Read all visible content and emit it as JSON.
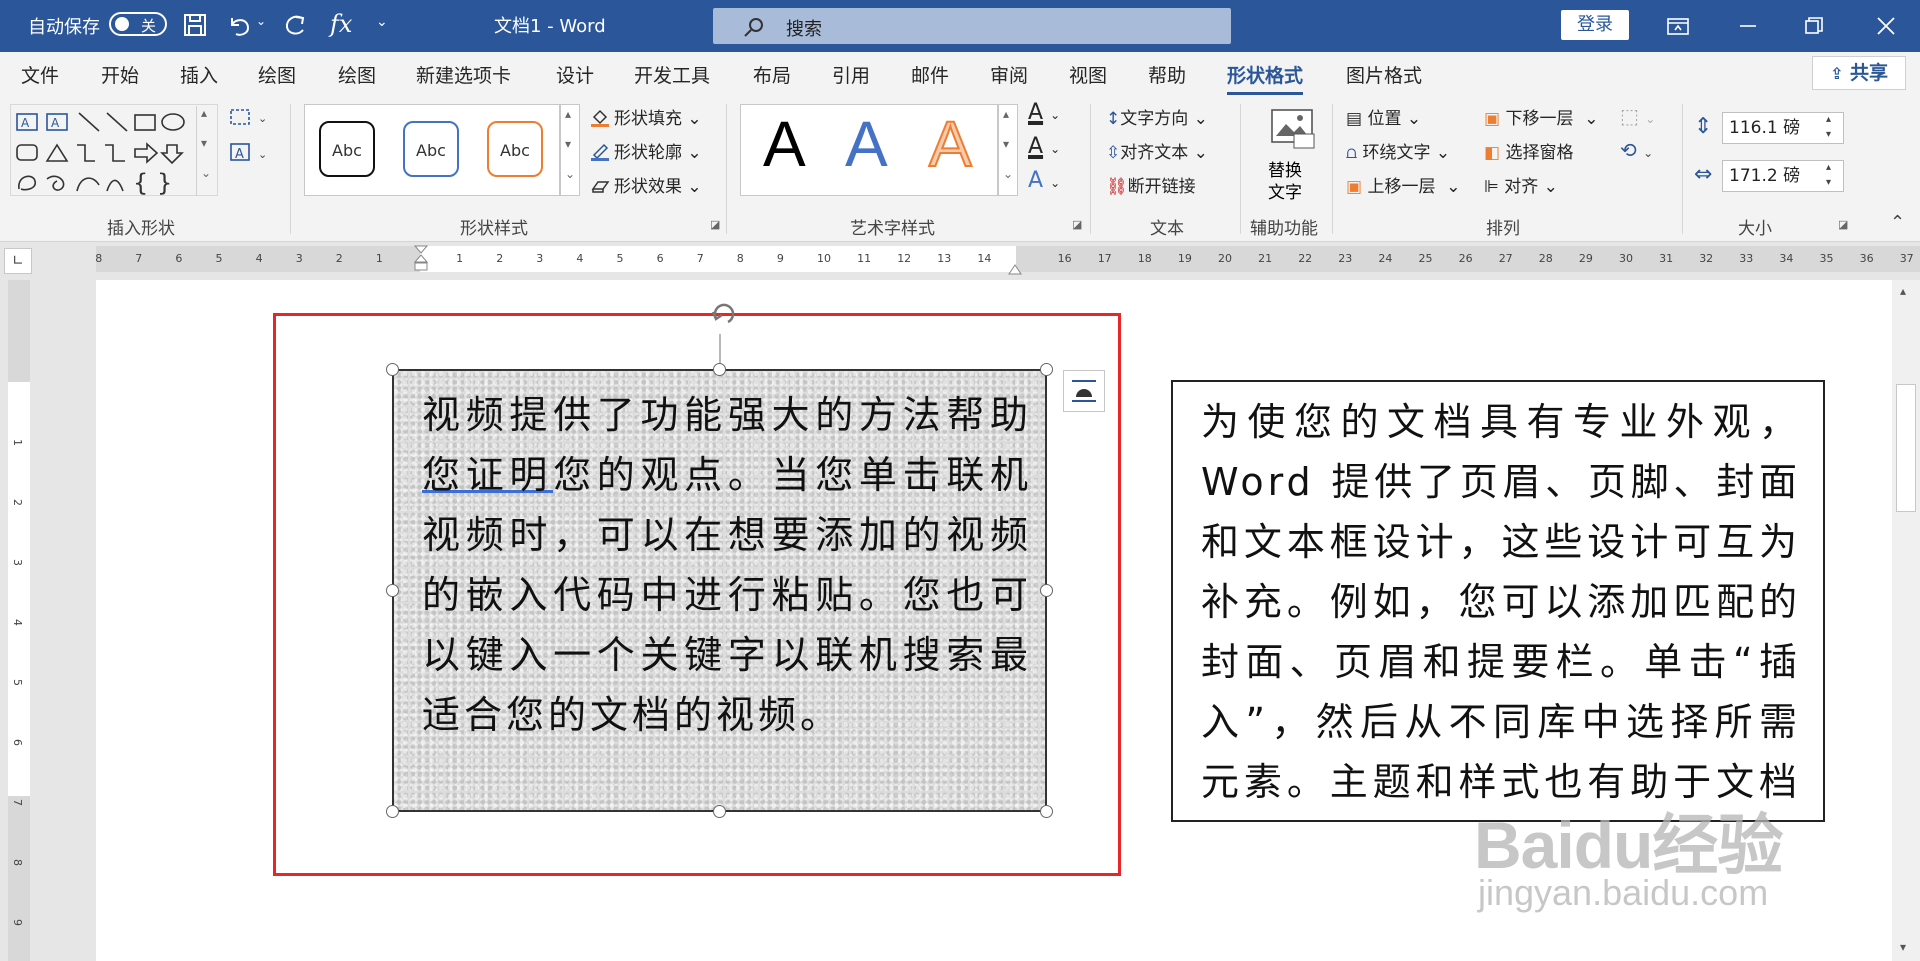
{
  "titlebar": {
    "autosave_label": "自动保存",
    "autosave_state": "关",
    "doc_title": "文档1  -  Word",
    "search_placeholder": "搜索",
    "login_label": "登录"
  },
  "tabs": [
    {
      "label": "文件",
      "active": false
    },
    {
      "label": "开始",
      "active": false
    },
    {
      "label": "插入",
      "active": false
    },
    {
      "label": "绘图",
      "active": false
    },
    {
      "label": "绘图",
      "active": false
    },
    {
      "label": "新建选项卡",
      "active": false
    },
    {
      "label": "设计",
      "active": false
    },
    {
      "label": "开发工具",
      "active": false
    },
    {
      "label": "布局",
      "active": false
    },
    {
      "label": "引用",
      "active": false
    },
    {
      "label": "邮件",
      "active": false
    },
    {
      "label": "审阅",
      "active": false
    },
    {
      "label": "视图",
      "active": false
    },
    {
      "label": "帮助",
      "active": false
    },
    {
      "label": "形状格式",
      "active": true
    },
    {
      "label": "图片格式",
      "active": false
    }
  ],
  "share_label": "共享",
  "ribbon": {
    "groups": {
      "insert_shapes": "插入形状",
      "shape_styles": "形状样式",
      "wordart_styles": "艺术字样式",
      "text": "文本",
      "accessibility": "辅助功能",
      "arrange": "排列",
      "size": "大小"
    },
    "style_gallery": [
      "Abc",
      "Abc",
      "Abc"
    ],
    "shape_fill": "形状填充",
    "shape_outline": "形状轮廓",
    "shape_effects": "形状效果",
    "wordart_letter": "A",
    "text_direction": "文字方向",
    "align_text": "对齐文本",
    "break_link": "断开链接",
    "alt_text_line1": "替换",
    "alt_text_line2": "文字",
    "position": "位置",
    "wrap_text": "环绕文字",
    "bring_forward": "上移一层",
    "send_backward": "下移一层",
    "selection_pane": "选择窗格",
    "align": "对齐",
    "height_value": "116.1 磅",
    "width_value": "171.2 磅"
  },
  "ruler": {
    "left_numbers": [
      "8",
      "7",
      "6",
      "5",
      "4",
      "3",
      "2",
      "1"
    ],
    "mid_numbers": [
      "1",
      "2",
      "3",
      "4",
      "5",
      "6",
      "7",
      "8",
      "9",
      "10",
      "11",
      "12",
      "13",
      "14"
    ],
    "right_numbers": [
      "16",
      "17",
      "18",
      "19",
      "20",
      "21",
      "22",
      "23",
      "24",
      "25",
      "26",
      "27",
      "28",
      "29",
      "30",
      "31",
      "32",
      "33",
      "34",
      "35",
      "36",
      "37"
    ],
    "vertical_numbers": [
      "1",
      "2",
      "3",
      "4",
      "5",
      "6",
      "7",
      "8",
      "9"
    ]
  },
  "document": {
    "shape1_text_pre": "视频提供了功能强大的方法帮助",
    "shape1_text_underlined": "您证明",
    "shape1_text_post": "您的观点。当您单击联机视频时，可以在想要添加的视频的嵌入代码中进行粘贴。您也可以键入一个关键字以联机搜索最适合您的文档的视频。",
    "shape2_text": "为使您的文档具有专业外观，Word 提供了页眉、页脚、封面和文本框设计，这些设计可互为补充。例如，您可以添加匹配的封面、页眉和提要栏。单击“插入”，然后从不同库中选择所需元素。主题和样式也有助于文档保持协"
  },
  "watermark": {
    "logo": "Baidu经验",
    "url": "jingyan.baidu.com"
  },
  "colors": {
    "titlebar": "#2b579a",
    "accent": "#2b579a",
    "red_frame": "#e8262a",
    "wordart_blue": "#4472c4",
    "wordart_orange": "#f4b183"
  }
}
